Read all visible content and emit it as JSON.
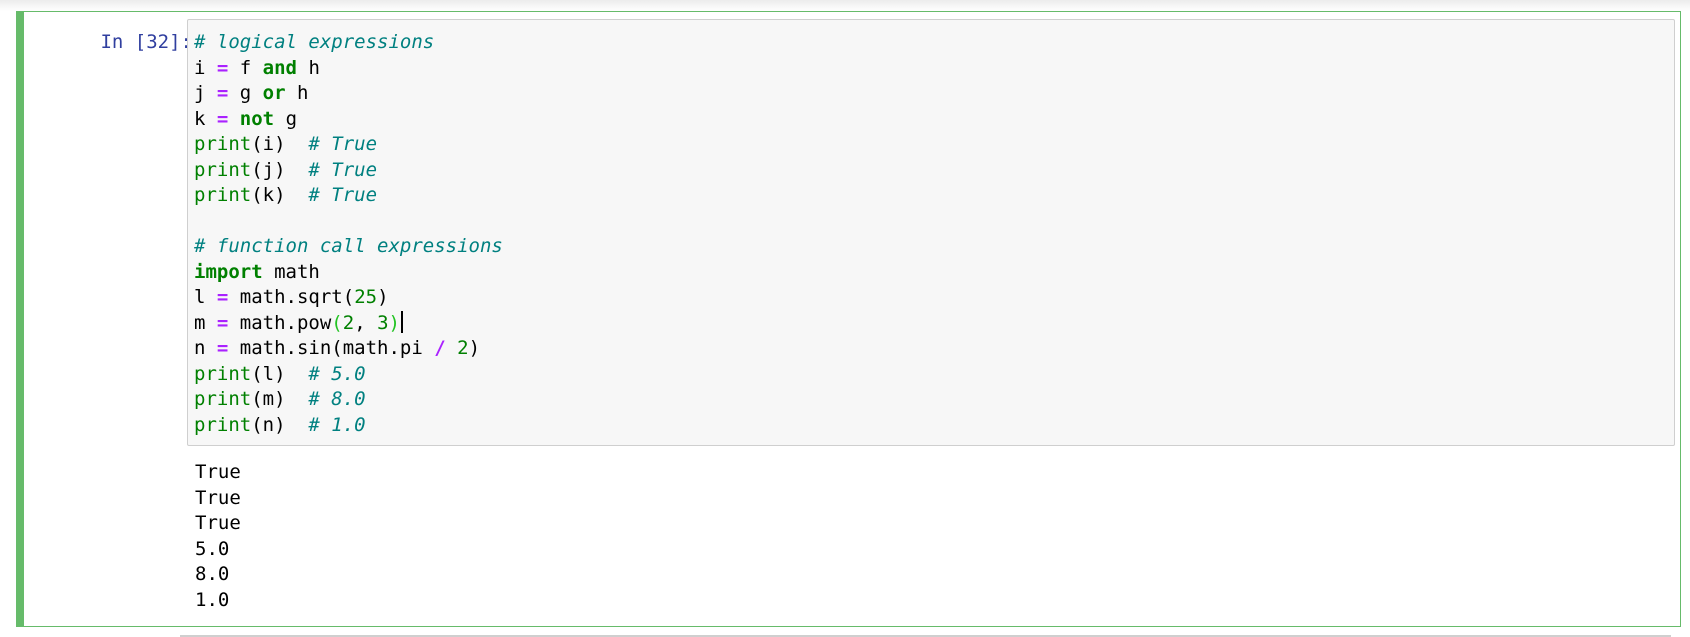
{
  "cell": {
    "prompt": "In [32]:",
    "execution_count": 32,
    "border_color": "#66bb6a",
    "code_lines": [
      [
        {
          "t": "# logical expressions",
          "c": "cm"
        }
      ],
      [
        {
          "t": "i ",
          "c": ""
        },
        {
          "t": "=",
          "c": "op"
        },
        {
          "t": " f ",
          "c": ""
        },
        {
          "t": "and",
          "c": "kw"
        },
        {
          "t": " h",
          "c": ""
        }
      ],
      [
        {
          "t": "j ",
          "c": ""
        },
        {
          "t": "=",
          "c": "op"
        },
        {
          "t": " g ",
          "c": ""
        },
        {
          "t": "or",
          "c": "kw"
        },
        {
          "t": " h",
          "c": ""
        }
      ],
      [
        {
          "t": "k ",
          "c": ""
        },
        {
          "t": "=",
          "c": "op"
        },
        {
          "t": " ",
          "c": ""
        },
        {
          "t": "not",
          "c": "kw"
        },
        {
          "t": " g",
          "c": ""
        }
      ],
      [
        {
          "t": "print",
          "c": "bi"
        },
        {
          "t": "(i)  ",
          "c": ""
        },
        {
          "t": "# True",
          "c": "cm"
        }
      ],
      [
        {
          "t": "print",
          "c": "bi"
        },
        {
          "t": "(j)  ",
          "c": ""
        },
        {
          "t": "# True",
          "c": "cm"
        }
      ],
      [
        {
          "t": "print",
          "c": "bi"
        },
        {
          "t": "(k)  ",
          "c": ""
        },
        {
          "t": "# True",
          "c": "cm"
        }
      ],
      [],
      [
        {
          "t": "# function call expressions",
          "c": "cm"
        }
      ],
      [
        {
          "t": "import",
          "c": "kw"
        },
        {
          "t": " math",
          "c": ""
        }
      ],
      [
        {
          "t": "l ",
          "c": ""
        },
        {
          "t": "=",
          "c": "op"
        },
        {
          "t": " math.sqrt(",
          "c": ""
        },
        {
          "t": "25",
          "c": "nu"
        },
        {
          "t": ")",
          "c": ""
        }
      ],
      [
        {
          "t": "m ",
          "c": ""
        },
        {
          "t": "=",
          "c": "op"
        },
        {
          "t": " math.pow",
          "c": ""
        },
        {
          "t": "(",
          "c": "mb"
        },
        {
          "t": "2",
          "c": "nu"
        },
        {
          "t": ", ",
          "c": ""
        },
        {
          "t": "3",
          "c": "nu"
        },
        {
          "t": ")",
          "c": "mb"
        },
        {
          "t": "",
          "c": "cursor"
        }
      ],
      [
        {
          "t": "n ",
          "c": ""
        },
        {
          "t": "=",
          "c": "op"
        },
        {
          "t": " math.sin(math.pi ",
          "c": ""
        },
        {
          "t": "/",
          "c": "op"
        },
        {
          "t": " ",
          "c": ""
        },
        {
          "t": "2",
          "c": "nu"
        },
        {
          "t": ")",
          "c": ""
        }
      ],
      [
        {
          "t": "print",
          "c": "bi"
        },
        {
          "t": "(l)  ",
          "c": ""
        },
        {
          "t": "# 5.0",
          "c": "cm"
        }
      ],
      [
        {
          "t": "print",
          "c": "bi"
        },
        {
          "t": "(m)  ",
          "c": ""
        },
        {
          "t": "# 8.0",
          "c": "cm"
        }
      ],
      [
        {
          "t": "print",
          "c": "bi"
        },
        {
          "t": "(n)  ",
          "c": ""
        },
        {
          "t": "# 1.0",
          "c": "cm"
        }
      ]
    ],
    "output_lines": [
      "True",
      "True",
      "True",
      "5.0",
      "8.0",
      "1.0"
    ]
  }
}
